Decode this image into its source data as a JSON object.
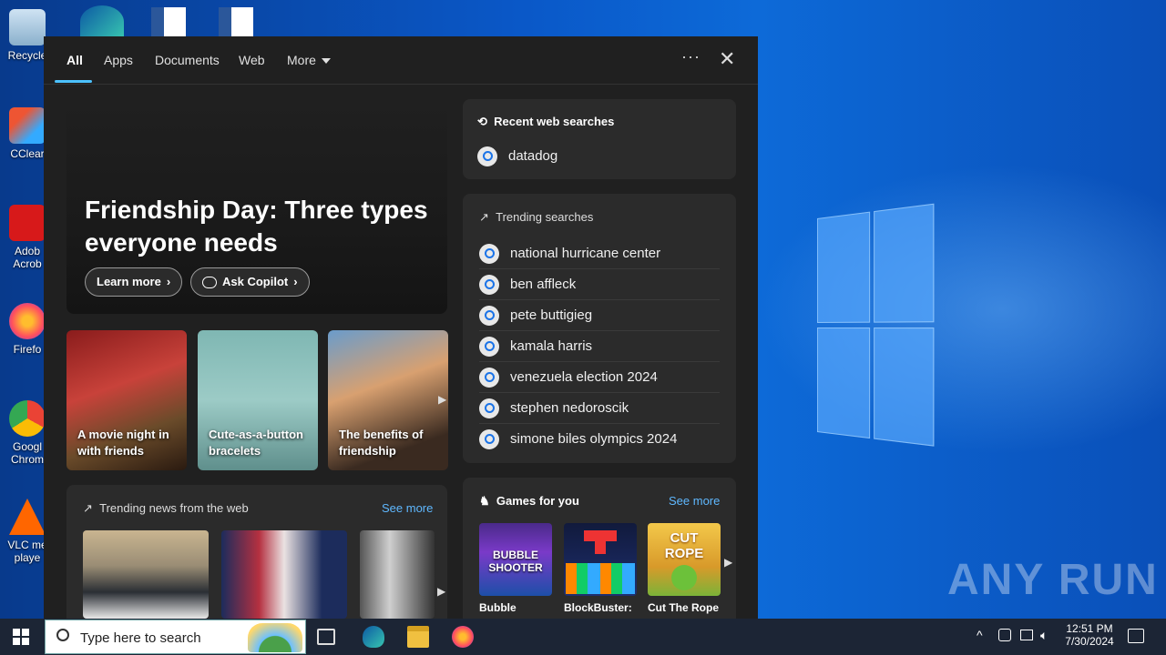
{
  "desktop": {
    "icons": [
      {
        "label": "Recycle"
      },
      {
        "label": "CClear"
      },
      {
        "label": "Adob Acrob"
      },
      {
        "label": "Firefo"
      },
      {
        "label": "Googl Chrom"
      },
      {
        "label": "VLC me playe"
      }
    ],
    "watermark": "ANY RUN"
  },
  "search_panel": {
    "tabs": [
      {
        "label": "All",
        "active": true
      },
      {
        "label": "Apps"
      },
      {
        "label": "Documents"
      },
      {
        "label": "Web"
      },
      {
        "label": "More"
      }
    ],
    "options_label": "···",
    "close_label": "✕",
    "hero": {
      "title": "Friendship Day: Three types everyone needs",
      "learn_more": "Learn more",
      "ask_copilot": "Ask Copilot"
    },
    "cards": [
      {
        "caption": "A movie night in with friends"
      },
      {
        "caption": "Cute-as-a-button bracelets"
      },
      {
        "caption": "The benefits of friendship"
      }
    ],
    "trending_news": {
      "title": "Trending news from the web",
      "see_more": "See more"
    },
    "recent": {
      "title": "Recent web searches",
      "items": [
        "datadog"
      ]
    },
    "trending_searches": {
      "title": "Trending searches",
      "items": [
        "national hurricane center",
        "ben affleck",
        "pete buttigieg",
        "kamala harris",
        "venezuela election 2024",
        "stephen nedoroscik",
        "simone biles olympics 2024"
      ]
    },
    "games": {
      "title": "Games for you",
      "see_more": "See more",
      "items": [
        {
          "name": "Bubble",
          "art": "BUBBLE SHOOTER"
        },
        {
          "name": "BlockBuster:",
          "art": ""
        },
        {
          "name": "Cut The Rope",
          "art": "CUT ROPE"
        }
      ]
    }
  },
  "taskbar": {
    "search_placeholder": "Type here to search",
    "time": "12:51 PM",
    "date": "7/30/2024"
  },
  "colors": {
    "accent": "#4cc2ff",
    "link": "#5fb8ff",
    "panel_bg": "#202020",
    "card_bg": "#2b2b2b"
  }
}
